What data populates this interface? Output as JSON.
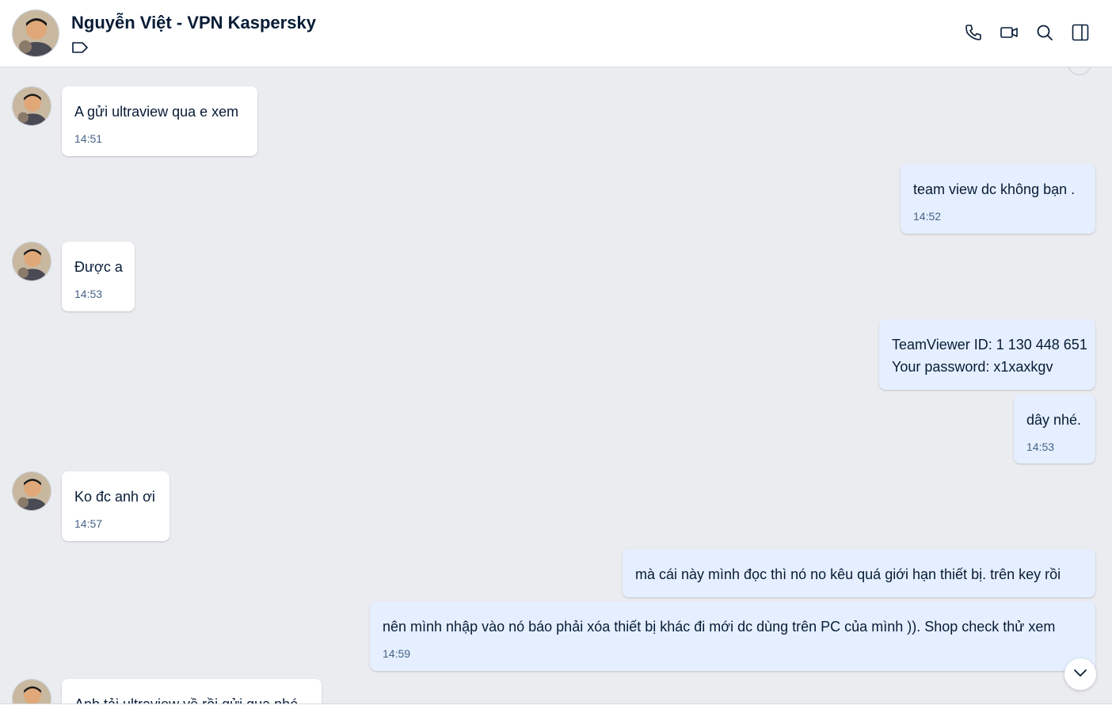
{
  "header": {
    "title": "Nguyễn Việt - VPN Kaspersky",
    "icons": [
      "phone-icon",
      "video-icon",
      "search-icon",
      "sidebar-toggle-icon",
      "tag-icon"
    ]
  },
  "messages": [
    {
      "direction": "in",
      "text": "A gửi ultraview qua e xem",
      "time": "14:51"
    },
    {
      "direction": "out",
      "text": "team view dc không bạn .",
      "time": "14:52"
    },
    {
      "direction": "in",
      "text": "Được a",
      "time": "14:53"
    },
    {
      "direction": "out",
      "lines": [
        "TeamViewer ID: 1 130 448 651",
        "Your password: x1xaxkgv"
      ]
    },
    {
      "direction": "out",
      "text": "dây nhé.",
      "time": "14:53"
    },
    {
      "direction": "in",
      "text": "Ko đc anh ơi",
      "time": "14:57"
    },
    {
      "direction": "out",
      "text": "mà cái này mình đọc thì nó no kêu quá giới hạn thiết bị. trên key rồi"
    },
    {
      "direction": "out",
      "text": "nên mình nhập vào nó báo phải xóa thiết bị khác đi mới dc dùng trên PC của mình )). Shop check thử xem",
      "time": "14:59"
    },
    {
      "direction": "in",
      "text": "Anh tải ultraview về rồi gửi qua nhé"
    }
  ],
  "colors": {
    "chat_bg": "#ebecf0",
    "incoming_bubble": "#ffffff",
    "outgoing_bubble": "#e5efff",
    "text": "#081c36",
    "time": "#476285"
  }
}
